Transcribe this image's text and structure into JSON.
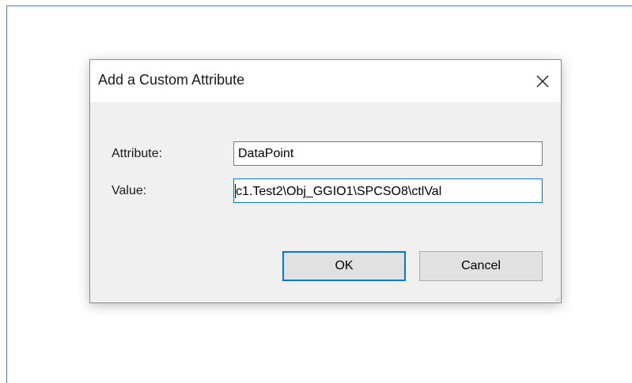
{
  "dialog": {
    "title": "Add a Custom Attribute",
    "close_icon": "close-x-icon",
    "fields": {
      "attribute": {
        "label": "Attribute:",
        "value": "DataPoint"
      },
      "value": {
        "label": "Value:",
        "value": "c1.Test2\\Obj_GGIO1\\SPCSO8\\ctlVal"
      }
    },
    "buttons": {
      "ok_label": "OK",
      "cancel_label": "Cancel"
    },
    "grip_icon": "resize-grip-icon"
  },
  "colors": {
    "accent": "#0078d7",
    "dialog_background": "#f0f0f0",
    "frame_border": "#4a7ebf",
    "button_face": "#e1e1e1"
  }
}
